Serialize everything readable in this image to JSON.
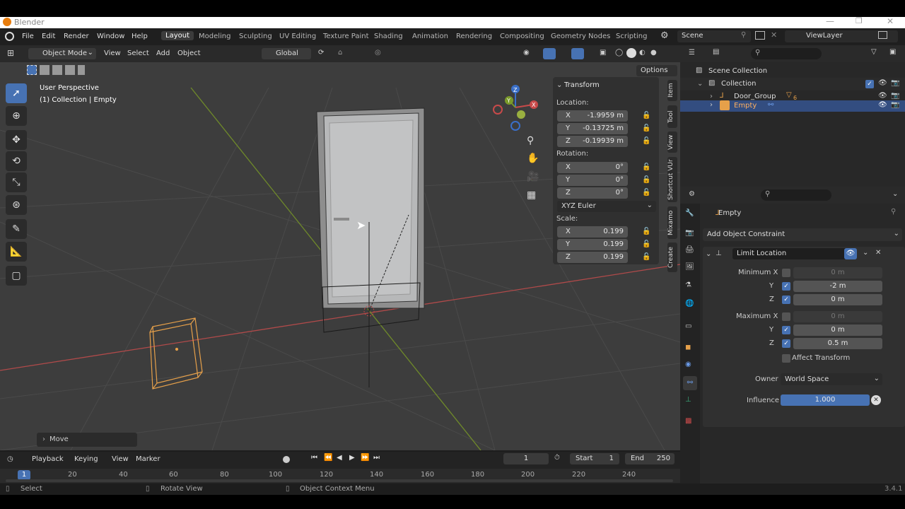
{
  "app": {
    "title": "Blender",
    "version": "3.4.1"
  },
  "menu": {
    "items": [
      "File",
      "Edit",
      "Render",
      "Window",
      "Help"
    ]
  },
  "workspaces": [
    "Layout",
    "Modeling",
    "Sculpting",
    "UV Editing",
    "Texture Paint",
    "Shading",
    "Animation",
    "Rendering",
    "Compositing",
    "Geometry Nodes",
    "Scripting"
  ],
  "active_workspace": "Layout",
  "scene": {
    "name": "Scene",
    "view_layer": "ViewLayer"
  },
  "viewport": {
    "mode": "Object Mode",
    "menus": [
      "View",
      "Select",
      "Add",
      "Object"
    ],
    "orientation": "Global",
    "options_label": "Options",
    "overlay_title": "User Perspective",
    "overlay_sub": "(1) Collection | Empty",
    "last_op": "Move"
  },
  "transform": {
    "title": "Transform",
    "location_label": "Location:",
    "location": {
      "x": "-1.9959 m",
      "y": "-0.13725 m",
      "z": "-0.19939 m"
    },
    "rotation_label": "Rotation:",
    "rotation": {
      "x": "0°",
      "y": "0°",
      "z": "0°"
    },
    "rotation_mode": "XYZ Euler",
    "scale_label": "Scale:",
    "scale": {
      "x": "0.199",
      "y": "0.199",
      "z": "0.199"
    }
  },
  "side_tabs": [
    "Item",
    "Tool",
    "View",
    "Shortcut VUr",
    "Mixamo",
    "Create"
  ],
  "outliner": {
    "scene_collection": "Scene Collection",
    "collection": "Collection",
    "door_group": "Door_Group",
    "door_badge": "6",
    "empty": "Empty"
  },
  "properties": {
    "object_name": "Empty",
    "add_constraint": "Add Object Constraint",
    "constraint_name": "Limit Location",
    "min_label": "Minimum X",
    "max_label": "Maximum X",
    "y_label": "Y",
    "z_label": "Z",
    "min": {
      "x": "0 m",
      "y": "-2 m",
      "z": "0 m"
    },
    "max": {
      "x": "0 m",
      "y": "0 m",
      "z": "0.5 m"
    },
    "affect_transform": "Affect Transform",
    "owner_label": "Owner",
    "owner_value": "World Space",
    "influence_label": "Influence",
    "influence_value": "1.000"
  },
  "timeline": {
    "menus": [
      "Playback",
      "Keying",
      "View",
      "Marker"
    ],
    "current_frame": "1",
    "start_label": "Start",
    "start": "1",
    "end_label": "End",
    "end": "250",
    "ticks": [
      "1",
      "20",
      "40",
      "60",
      "80",
      "100",
      "120",
      "140",
      "160",
      "180",
      "200",
      "220",
      "240"
    ]
  },
  "status": {
    "select": "Select",
    "rotate": "Rotate View",
    "context": "Object Context Menu"
  },
  "colors": {
    "accent": "#4772b3",
    "selected_row": "#334d80",
    "x_axis": "#c84a4a",
    "y_axis": "#7a9a2a",
    "z_axis": "#3a6fc8",
    "empty": "#e6a04a"
  }
}
